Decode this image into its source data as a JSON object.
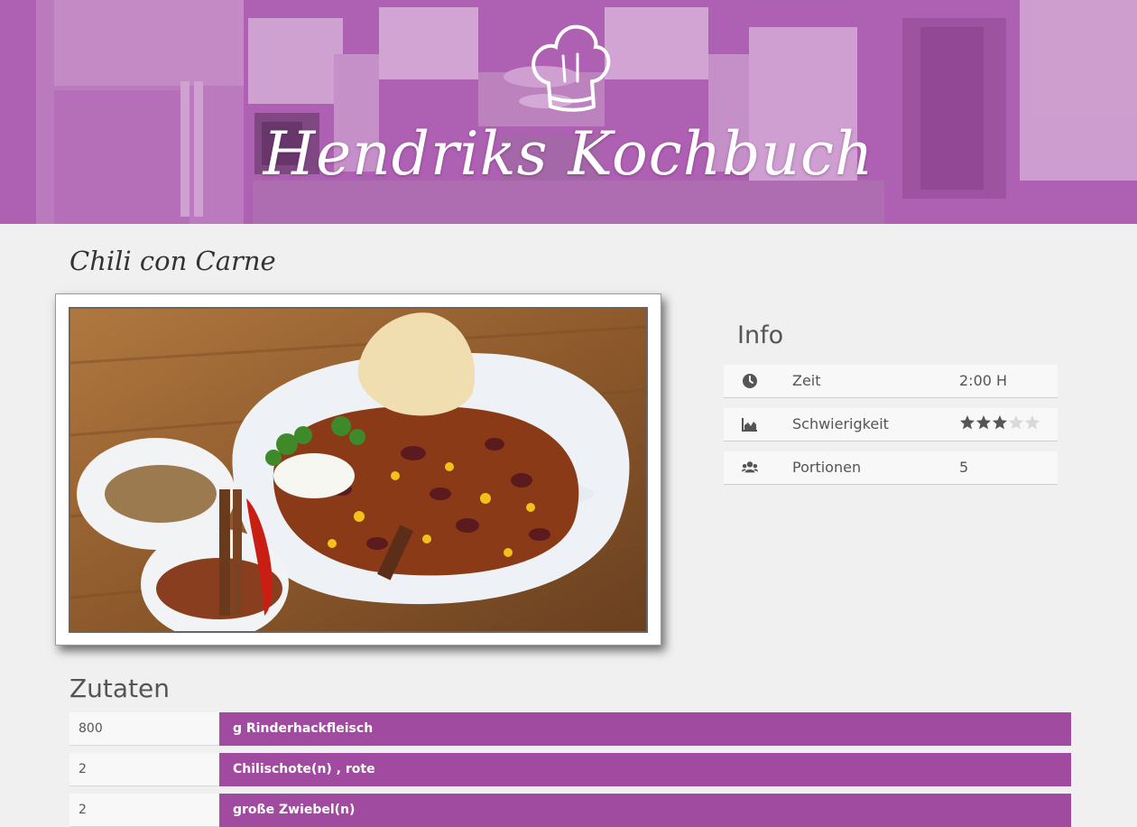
{
  "site": {
    "brand_title": "Hendriks Kochbuch"
  },
  "recipe": {
    "title": "Chili con Carne"
  },
  "info": {
    "heading": "Info",
    "rows": [
      {
        "icon": "clock-icon",
        "label": "Zeit",
        "value": "2:00 H"
      },
      {
        "icon": "area-chart-icon",
        "label": "Schwierigkeit",
        "rating": 3,
        "rating_max": 5
      },
      {
        "icon": "users-icon",
        "label": "Portionen",
        "value": "5"
      }
    ]
  },
  "ingredients": {
    "heading": "Zutaten",
    "items": [
      {
        "amount": "800",
        "name": "g Rinderhackfleisch"
      },
      {
        "amount": "2",
        "name": "Chilischote(n) , rote"
      },
      {
        "amount": "2",
        "name": "große Zwiebel(n)"
      }
    ]
  },
  "colors": {
    "accent": "#a04aa0",
    "background": "#f0f0f0",
    "row": "#f8f8f8"
  }
}
